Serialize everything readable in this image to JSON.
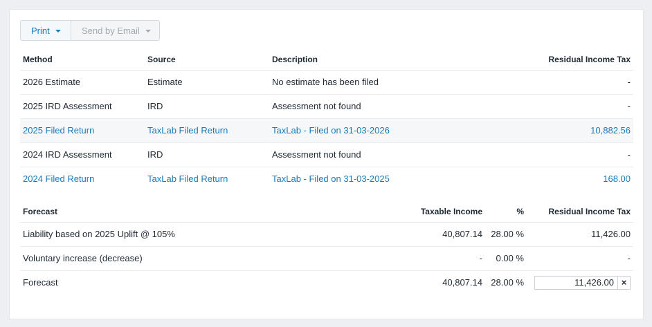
{
  "toolbar": {
    "print_label": "Print",
    "email_label": "Send by Email"
  },
  "methods": {
    "headers": {
      "method": "Method",
      "source": "Source",
      "description": "Description",
      "rit": "Residual Income Tax"
    },
    "rows": [
      {
        "method": "2026 Estimate",
        "source": "Estimate",
        "description": "No estimate has been filed",
        "rit": "-"
      },
      {
        "method": "2025 IRD Assessment",
        "source": "IRD",
        "description": "Assessment not found",
        "rit": "-"
      },
      {
        "method": "2025 Filed Return",
        "source": "TaxLab Filed Return",
        "description": "TaxLab - Filed on 31-03-2026",
        "rit": "10,882.56"
      },
      {
        "method": "2024 IRD Assessment",
        "source": "IRD",
        "description": "Assessment not found",
        "rit": "-"
      },
      {
        "method": "2024 Filed Return",
        "source": "TaxLab Filed Return",
        "description": "TaxLab - Filed on 31-03-2025",
        "rit": "168.00"
      }
    ]
  },
  "forecast": {
    "headers": {
      "forecast": "Forecast",
      "taxable_income": "Taxable Income",
      "percent": "%",
      "rit": "Residual Income Tax"
    },
    "rows": [
      {
        "label": "Liability based on 2025 Uplift @ 105%",
        "taxable_income": "40,807.14",
        "percent": "28.00 %",
        "rit": "11,426.00"
      },
      {
        "label": "Voluntary increase (decrease)",
        "taxable_income": "-",
        "percent": "0.00 %",
        "rit": "-"
      },
      {
        "label": "Forecast",
        "taxable_income": "40,807.14",
        "percent": "28.00 %",
        "rit_input_value": "11,426.00",
        "clear_symbol": "×"
      }
    ]
  },
  "colors": {
    "link": "#1a7bb8",
    "background": "#eeeff2",
    "highlight_row": "#f5f7f8"
  }
}
